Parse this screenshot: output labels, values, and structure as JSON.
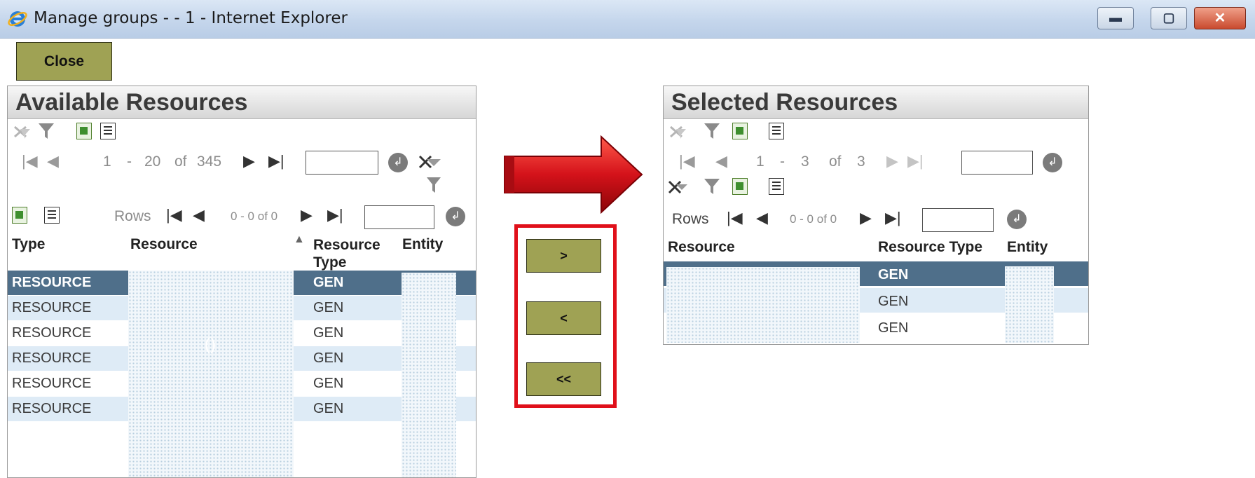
{
  "window": {
    "title": "Manage groups - - 1 - Internet Explorer",
    "min_glyph": "▬",
    "max_glyph": "▢",
    "close_glyph": "✕"
  },
  "toolbar": {
    "close_label": "Close"
  },
  "available": {
    "title": "Available Resources",
    "pager": {
      "first": "1",
      "dash": "-",
      "last": "20",
      "of": "of",
      "total": "345",
      "go": "↲"
    },
    "sub_pager": {
      "rows_label": "Rows",
      "range": "0 - 0 of 0",
      "go": "↲"
    },
    "columns": [
      "Type",
      "Resource",
      "Resource Type",
      "Entity"
    ],
    "sort_indicator": "▲",
    "resource_col_value": "()",
    "rows": [
      {
        "type": "RESOURCE",
        "resource_type": "GEN",
        "selected": true
      },
      {
        "type": "RESOURCE",
        "resource_type": "GEN",
        "selected": false
      },
      {
        "type": "RESOURCE",
        "resource_type": "GEN",
        "selected": false
      },
      {
        "type": "RESOURCE",
        "resource_type": "GEN",
        "selected": false
      },
      {
        "type": "RESOURCE",
        "resource_type": "GEN",
        "selected": false
      },
      {
        "type": "RESOURCE",
        "resource_type": "GEN",
        "selected": false
      }
    ]
  },
  "move_buttons": {
    "add": ">",
    "remove": "<",
    "remove_all": "<<"
  },
  "selected": {
    "title": "Selected Resources",
    "pager": {
      "first": "1",
      "dash": "-",
      "last": "3",
      "of": "of",
      "total": "3",
      "go": "↲"
    },
    "sub_pager": {
      "rows_label": "Rows",
      "range": "0 - 0 of 0",
      "go": "↲"
    },
    "columns": [
      "Resource",
      "Resource Type",
      "Entity"
    ],
    "rows": [
      {
        "resource_type": "GEN",
        "selected": true
      },
      {
        "resource_type": "GEN",
        "selected": false
      },
      {
        "resource_type": "GEN",
        "selected": false
      }
    ]
  },
  "colors": {
    "accent_button": "#9fa254",
    "selected_row": "#4f6f8a",
    "highlight_box": "#e0101a",
    "arrow": "#d4121a"
  },
  "icons": [
    "ie-logo-icon",
    "clear-filter-icon",
    "filter-icon",
    "excel-export-icon",
    "column-chooser-icon",
    "first-page-icon",
    "prev-page-icon",
    "next-page-icon",
    "last-page-icon",
    "go-icon",
    "right-arrow-icon"
  ]
}
